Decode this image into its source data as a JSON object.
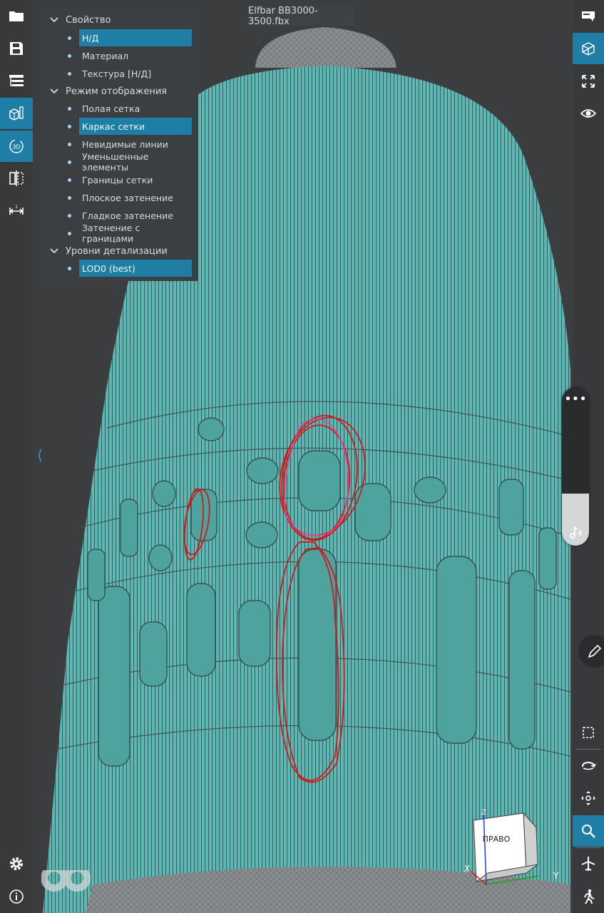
{
  "window": {
    "title": "Elfbar BB3000-3500.fbx"
  },
  "colors": {
    "accent": "#1f7ea6",
    "mesh_fill": "#5ab5b1",
    "wire": "#3a4a4a",
    "toolbar_bg": "#37393b",
    "panel_bg": "#3c3f41",
    "annotation": "#d01818"
  },
  "left_toolbar": {
    "items": [
      {
        "icon": "folder-icon",
        "active": false
      },
      {
        "icon": "save-icon",
        "active": false
      },
      {
        "icon": "tree-icon",
        "active": false
      },
      {
        "icon": "display-mode-icon",
        "active": true
      },
      {
        "icon": "3d-icon",
        "active": true,
        "label": "3D"
      },
      {
        "icon": "section-icon",
        "active": false
      },
      {
        "icon": "measure-icon",
        "active": false
      }
    ],
    "bottom": [
      {
        "icon": "gear-icon"
      },
      {
        "icon": "info-icon"
      }
    ]
  },
  "right_toolbar": {
    "items": [
      {
        "icon": "view-tag-icon",
        "active": false
      },
      {
        "icon": "wireframe-cube-icon",
        "active": true
      },
      {
        "icon": "fit-view-icon",
        "active": false
      },
      {
        "icon": "eye-icon",
        "active": false
      },
      {
        "icon": "select-box-icon",
        "active": false
      },
      {
        "icon": "orbit-icon",
        "active": false
      },
      {
        "icon": "pan-icon",
        "active": false
      },
      {
        "icon": "zoom-icon",
        "active": true
      },
      {
        "icon": "fly-icon",
        "active": false
      },
      {
        "icon": "walk-icon",
        "active": false
      }
    ]
  },
  "properties_panel": {
    "categories": [
      {
        "label": "Свойство",
        "options": [
          {
            "label": "Н/Д",
            "selected": true
          },
          {
            "label": "Материал",
            "selected": false
          },
          {
            "label": "Текстура [Н/Д]",
            "selected": false
          }
        ]
      },
      {
        "label": "Режим отображения",
        "options": [
          {
            "label": "Полая сетка",
            "selected": false
          },
          {
            "label": "Каркас сетки",
            "selected": true
          },
          {
            "label": "Невидимые линии",
            "selected": false
          },
          {
            "label": "Уменьшенные элементы",
            "selected": false
          },
          {
            "label": "Границы сетки",
            "selected": false
          },
          {
            "label": "Плоское затенение",
            "selected": false
          },
          {
            "label": "Гладкое затенение",
            "selected": false
          },
          {
            "label": "Затенение с границами",
            "selected": false
          }
        ]
      },
      {
        "label": "Уровни детализации",
        "options": [
          {
            "label": "LOD0 (best)",
            "selected": true
          }
        ]
      }
    ]
  },
  "volume": {
    "level": 0.33,
    "icon": "music-volume-icon",
    "menu_icon": "more-dots-icon"
  },
  "pen": {
    "icon": "pencil-icon"
  },
  "nav_cube": {
    "face_label": "ПРАВО",
    "axis_x": "X",
    "axis_y": "Y",
    "axis_z": "Z"
  },
  "collapse": {
    "icon": "chevron-left-icon"
  },
  "logo": {
    "icon": "app-logo-icon"
  }
}
